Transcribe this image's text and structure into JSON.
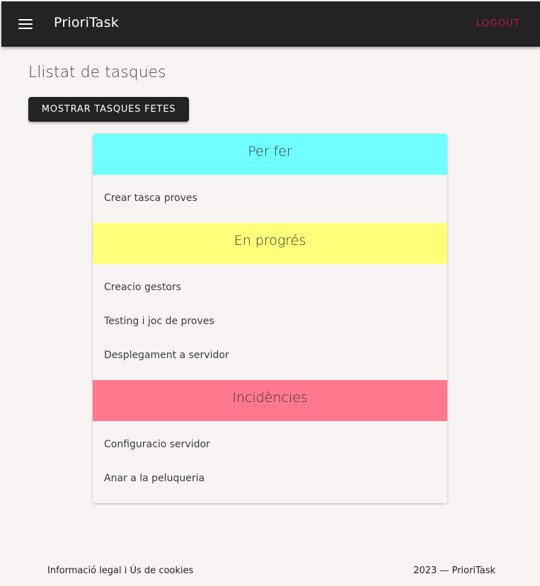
{
  "app": {
    "title": "PrioriTask",
    "logout_label": "LOGOUT"
  },
  "main": {
    "page_title": "Llistat de tasques",
    "show_done_label": "MOSTRAR TASQUES FETES"
  },
  "columns": [
    {
      "title": "Per fer",
      "color": "#70ffff",
      "tasks": [
        "Crear tasca proves"
      ]
    },
    {
      "title": "En progrés",
      "color": "#ffff7a",
      "tasks": [
        "Creacio gestors",
        "Testing i joc de proves",
        "Desplegament a servidor"
      ]
    },
    {
      "title": "Incidències",
      "color": "#ff788e",
      "tasks": [
        "Configuracio servidor",
        "Anar a la peluqueria"
      ]
    }
  ],
  "footer": {
    "legal": "Informació legal i Ús de cookies",
    "copyright": "2023 — PrioriTask"
  },
  "icons": {
    "menu": "menu-icon"
  }
}
